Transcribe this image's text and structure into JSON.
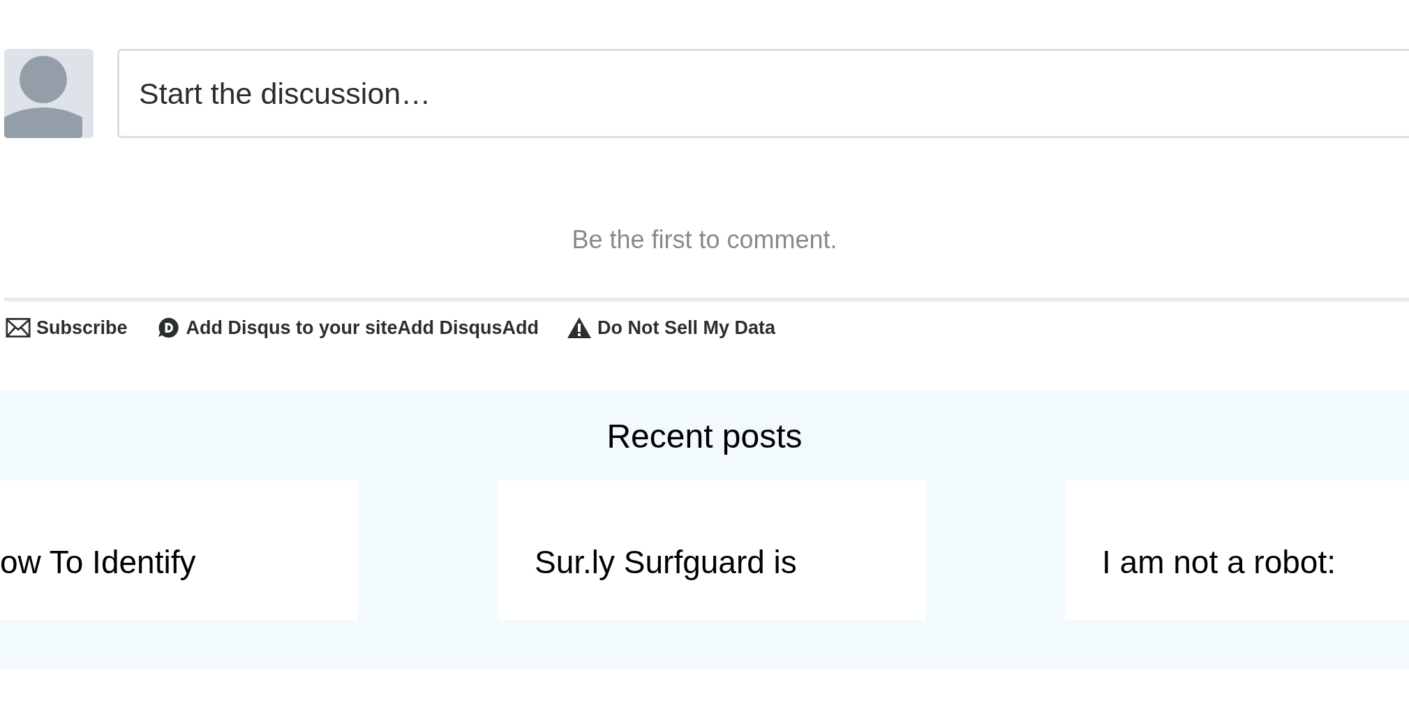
{
  "comment_box": {
    "placeholder": "Start the discussion…"
  },
  "empty_message": "Be the first to comment.",
  "footer_links": [
    {
      "kind": "subscribe",
      "label": "Subscribe"
    },
    {
      "kind": "disqus",
      "label": "Add Disqus to your siteAdd DisqusAdd"
    },
    {
      "kind": "warning",
      "label": "Do Not Sell My Data"
    }
  ],
  "recent_posts": {
    "title": "Recent posts",
    "posts": [
      {
        "title": "ow To Identify"
      },
      {
        "title": "Sur.ly Surfguard is"
      },
      {
        "title": "I am not a robot:"
      }
    ]
  }
}
